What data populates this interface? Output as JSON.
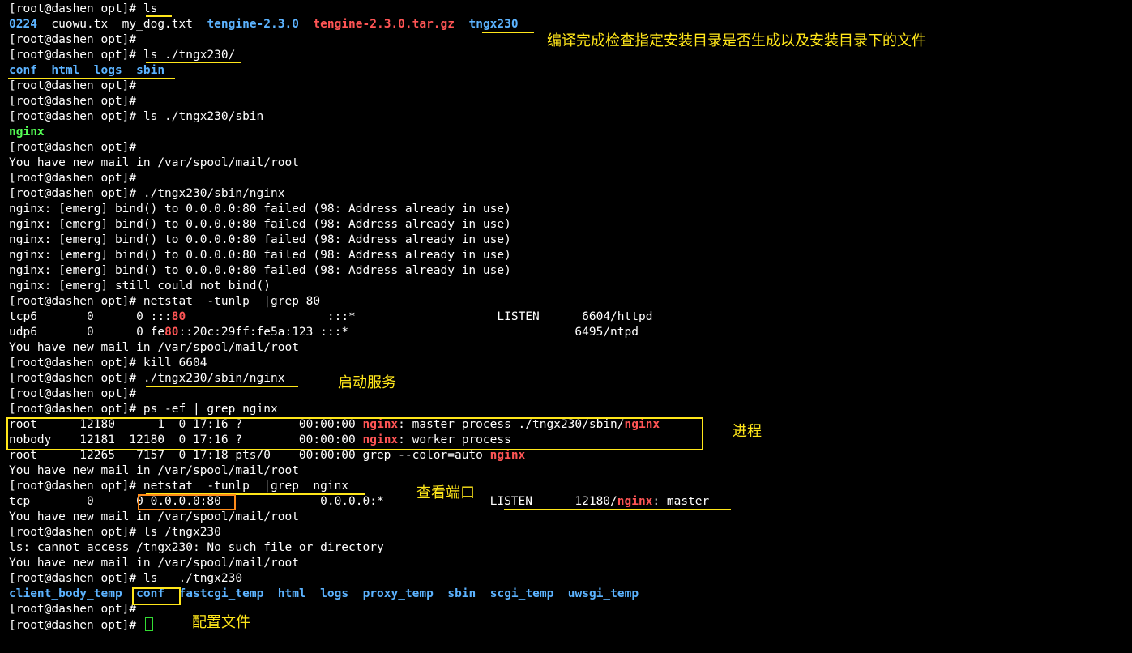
{
  "colors": {
    "background": "#000000",
    "text": "#ffffff",
    "dir_blue": "#5cb3ff",
    "archive_red": "#ff5555",
    "exec_green": "#55ff55",
    "annotation_yellow": "#ffe61a",
    "annotation_orange": "#ff8c1a",
    "cursor": "#33dd33"
  },
  "terminal": {
    "lines": [
      [
        {
          "t": "[root@dashen opt]# ls"
        }
      ],
      [
        {
          "t": "0224",
          "c": "blue"
        },
        {
          "t": "  cuowu.tx  my_dog.txt  "
        },
        {
          "t": "tengine-2.3.0",
          "c": "blue"
        },
        {
          "t": "  "
        },
        {
          "t": "tengine-2.3.0.tar.gz",
          "c": "red"
        },
        {
          "t": "  "
        },
        {
          "t": "tngx230",
          "c": "blue"
        }
      ],
      [
        {
          "t": "[root@dashen opt]#"
        }
      ],
      [
        {
          "t": "[root@dashen opt]# ls ./tngx230/"
        }
      ],
      [
        {
          "t": "conf",
          "c": "blue"
        },
        {
          "t": "  "
        },
        {
          "t": "html",
          "c": "blue"
        },
        {
          "t": "  "
        },
        {
          "t": "logs",
          "c": "blue"
        },
        {
          "t": "  "
        },
        {
          "t": "sbin",
          "c": "blue"
        }
      ],
      [
        {
          "t": "[root@dashen opt]#"
        }
      ],
      [
        {
          "t": "[root@dashen opt]#"
        }
      ],
      [
        {
          "t": "[root@dashen opt]# ls ./tngx230/sbin"
        }
      ],
      [
        {
          "t": "nginx",
          "c": "green"
        }
      ],
      [
        {
          "t": "[root@dashen opt]#"
        }
      ],
      [
        {
          "t": "You have new mail in /var/spool/mail/root"
        }
      ],
      [
        {
          "t": "[root@dashen opt]#"
        }
      ],
      [
        {
          "t": "[root@dashen opt]# ./tngx230/sbin/nginx"
        }
      ],
      [
        {
          "t": "nginx: [emerg] bind() to 0.0.0.0:80 failed (98: Address already in use)"
        }
      ],
      [
        {
          "t": "nginx: [emerg] bind() to 0.0.0.0:80 failed (98: Address already in use)"
        }
      ],
      [
        {
          "t": "nginx: [emerg] bind() to 0.0.0.0:80 failed (98: Address already in use)"
        }
      ],
      [
        {
          "t": "nginx: [emerg] bind() to 0.0.0.0:80 failed (98: Address already in use)"
        }
      ],
      [
        {
          "t": "nginx: [emerg] bind() to 0.0.0.0:80 failed (98: Address already in use)"
        }
      ],
      [
        {
          "t": "nginx: [emerg] still could not bind()"
        }
      ],
      [
        {
          "t": "[root@dashen opt]# netstat  -tunlp  |grep 80"
        }
      ],
      [
        {
          "t": "tcp6       0      0 :::"
        },
        {
          "t": "80",
          "c": "red"
        },
        {
          "t": "                    :::*                    LISTEN      6604/httpd"
        }
      ],
      [
        {
          "t": "udp6       0      0 fe"
        },
        {
          "t": "80",
          "c": "red"
        },
        {
          "t": "::20c:29ff:fe5a:123 :::*                                6495/ntpd"
        }
      ],
      [
        {
          "t": "You have new mail in /var/spool/mail/root"
        }
      ],
      [
        {
          "t": "[root@dashen opt]# kill 6604"
        }
      ],
      [
        {
          "t": "[root@dashen opt]# ./tngx230/sbin/nginx"
        }
      ],
      [
        {
          "t": "[root@dashen opt]#"
        }
      ],
      [
        {
          "t": "[root@dashen opt]# ps -ef | grep nginx"
        }
      ],
      [
        {
          "t": "root      12180      1  0 17:16 ?        00:00:00 "
        },
        {
          "t": "nginx",
          "c": "red"
        },
        {
          "t": ": master process ./tngx230/sbin/"
        },
        {
          "t": "nginx",
          "c": "red"
        }
      ],
      [
        {
          "t": "nobody    12181  12180  0 17:16 ?        00:00:00 "
        },
        {
          "t": "nginx",
          "c": "red"
        },
        {
          "t": ": worker process"
        }
      ],
      [
        {
          "t": "root      12265   7157  0 17:18 pts/0    00:00:00 grep --color=auto "
        },
        {
          "t": "nginx",
          "c": "red"
        }
      ],
      [
        {
          "t": "You have new mail in /var/spool/mail/root"
        }
      ],
      [
        {
          "t": "[root@dashen opt]# netstat  -tunlp  |grep  nginx"
        }
      ],
      [
        {
          "t": "tcp        0      0 0.0.0.0:80              0.0.0.0:*               LISTEN      12180/"
        },
        {
          "t": "nginx",
          "c": "red"
        },
        {
          "t": ": master"
        }
      ],
      [
        {
          "t": "You have new mail in /var/spool/mail/root"
        }
      ],
      [
        {
          "t": "[root@dashen opt]# ls /tngx230"
        }
      ],
      [
        {
          "t": "ls: cannot access /tngx230: No such file or directory"
        }
      ],
      [
        {
          "t": "You have new mail in /var/spool/mail/root"
        }
      ],
      [
        {
          "t": "[root@dashen opt]# ls   ./tngx230"
        }
      ],
      [
        {
          "t": "client_body_temp",
          "c": "blue"
        },
        {
          "t": "  "
        },
        {
          "t": "conf",
          "c": "blue"
        },
        {
          "t": "  "
        },
        {
          "t": "fastcgi_temp",
          "c": "blue"
        },
        {
          "t": "  "
        },
        {
          "t": "html",
          "c": "blue"
        },
        {
          "t": "  "
        },
        {
          "t": "logs",
          "c": "blue"
        },
        {
          "t": "  "
        },
        {
          "t": "proxy_temp",
          "c": "blue"
        },
        {
          "t": "  "
        },
        {
          "t": "sbin",
          "c": "blue"
        },
        {
          "t": "  "
        },
        {
          "t": "scgi_temp",
          "c": "blue"
        },
        {
          "t": "  "
        },
        {
          "t": "uwsgi_temp",
          "c": "blue"
        }
      ],
      [
        {
          "t": "[root@dashen opt]#"
        }
      ],
      [
        {
          "t": "[root@dashen opt]# "
        }
      ]
    ]
  },
  "annotations": {
    "install_check": "编译完成检查指定安装目录是否生成以及安装目录下的文件",
    "start_service": "启动服务",
    "process": "进程",
    "check_port": "查看端口",
    "config_file": "配置文件"
  }
}
